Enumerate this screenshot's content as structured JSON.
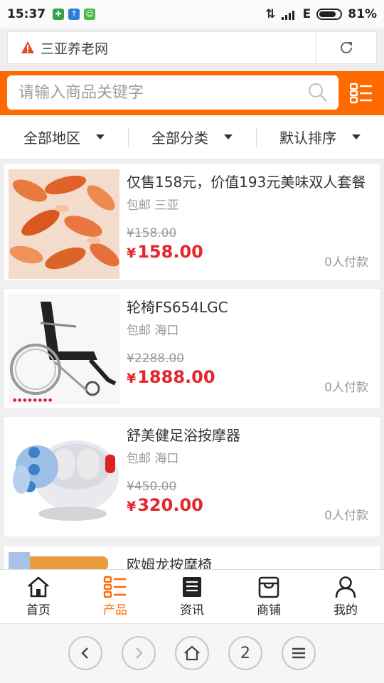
{
  "status_bar": {
    "time": "15:37",
    "network": "E",
    "battery_text": "81%",
    "battery_level": 0.81
  },
  "url_bar": {
    "site_title": "三亚养老网"
  },
  "search": {
    "placeholder": "请输入商品关键字"
  },
  "filters": [
    {
      "label": "全部地区"
    },
    {
      "label": "全部分类"
    },
    {
      "label": "默认排序"
    }
  ],
  "products": [
    {
      "name": "仅售158元，价值193元美味双人套餐",
      "meta": "包邮 三亚",
      "original_price": "¥158.00",
      "currency": "¥",
      "price": "158.00",
      "paid": "0人付款"
    },
    {
      "name": "轮椅FS654LGC",
      "meta": "包邮 海口",
      "original_price": "¥2288.00",
      "currency": "¥",
      "price": "1888.00",
      "paid": "0人付款"
    },
    {
      "name": "舒美健足浴按摩器",
      "meta": "包邮 海口",
      "original_price": "¥450.00",
      "currency": "¥",
      "price": "320.00",
      "paid": "0人付款"
    },
    {
      "name": "欧姆龙按摩椅"
    }
  ],
  "tabs": [
    {
      "label": "首页",
      "icon": "home-icon"
    },
    {
      "label": "产品",
      "icon": "grid-list-icon",
      "active": true
    },
    {
      "label": "资讯",
      "icon": "news-icon"
    },
    {
      "label": "商铺",
      "icon": "store-icon"
    },
    {
      "label": "我的",
      "icon": "user-icon"
    }
  ],
  "browser_nav": {
    "tab_count": "2"
  },
  "colors": {
    "accent": "#ff6a00",
    "price": "#e4262d",
    "muted": "#999999"
  }
}
